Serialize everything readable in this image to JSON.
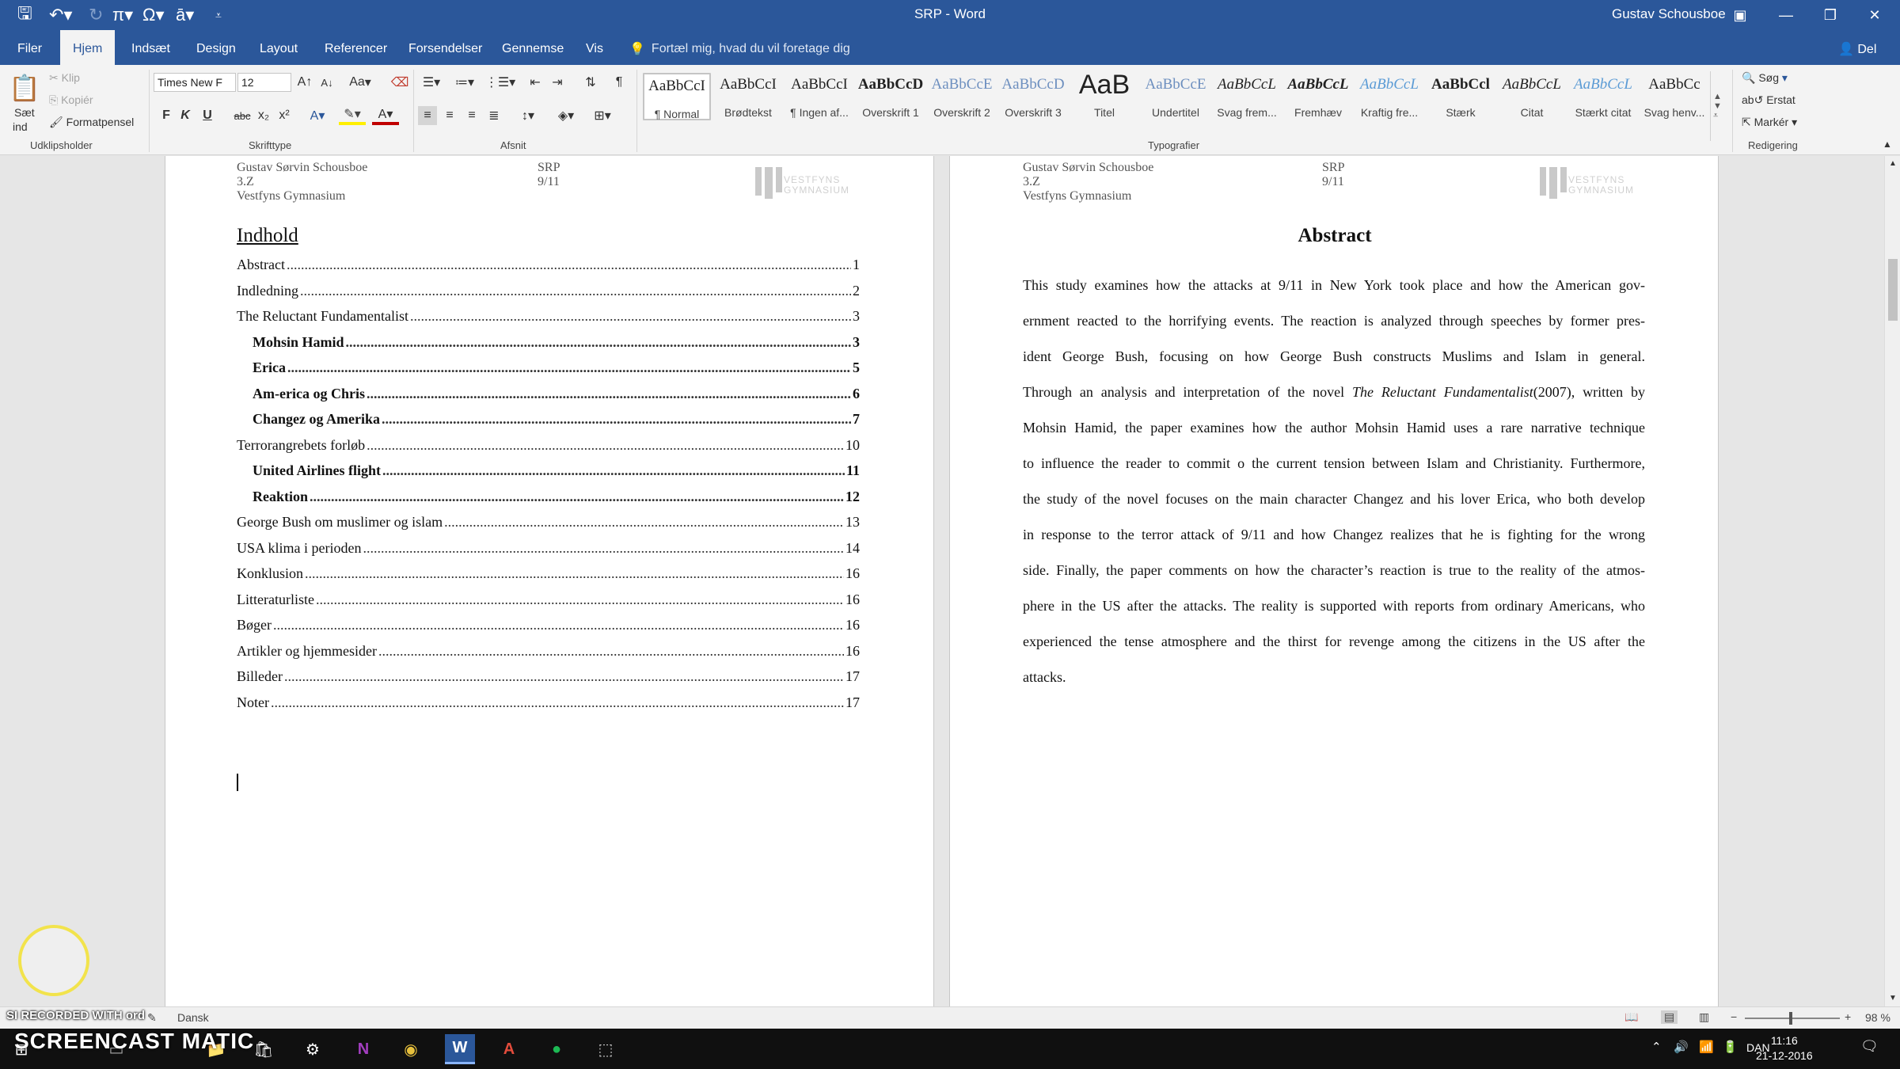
{
  "window": {
    "title": "SRP - Word",
    "user": "Gustav Schousboe"
  },
  "tabs": [
    "Filer",
    "Hjem",
    "Indsæt",
    "Design",
    "Layout",
    "Referencer",
    "Forsendelser",
    "Gennemse",
    "Vis"
  ],
  "active_tab": "Hjem",
  "tell_me": "Fortæl mig, hvad du vil foretage dig",
  "share": "Del",
  "clipboard": {
    "paste": "Sæt",
    "paste2": "ind",
    "cut": "Klip",
    "copy": "Kopiér",
    "format_painter": "Formatpensel",
    "label": "Udklipsholder"
  },
  "font": {
    "name": "Times New F",
    "size": "12",
    "label": "Skrifttype",
    "bold": "F",
    "italic": "K",
    "underline": "U",
    "strike": "abc",
    "sub": "x₂",
    "sup": "x²",
    "case": "Aa"
  },
  "paragraph": {
    "label": "Afsnit"
  },
  "styles": {
    "label": "Typografier",
    "items": [
      {
        "preview": "AaBbCcI",
        "name": "¶ Normal",
        "selected": true
      },
      {
        "preview": "AaBbCcI",
        "name": "Brødtekst"
      },
      {
        "preview": "AaBbCcI",
        "name": "¶ Ingen af..."
      },
      {
        "preview": "AaBbCcD",
        "name": "Overskrift 1"
      },
      {
        "preview": "AaBbCcE",
        "name": "Overskrift 2"
      },
      {
        "preview": "AaBbCcD",
        "name": "Overskrift 3"
      },
      {
        "preview": "AaB",
        "name": "Titel"
      },
      {
        "preview": "AaBbCcE",
        "name": "Undertitel"
      },
      {
        "preview": "AaBbCcL",
        "name": "Svag frem..."
      },
      {
        "preview": "AaBbCcL",
        "name": "Fremhæv"
      },
      {
        "preview": "AaBbCcL",
        "name": "Kraftig fre..."
      },
      {
        "preview": "AaBbCcl",
        "name": "Stærk"
      },
      {
        "preview": "AaBbCcL",
        "name": "Citat"
      },
      {
        "preview": "AaBbCcL",
        "name": "Stærkt citat"
      },
      {
        "preview": "AaBbCc",
        "name": "Svag henv..."
      }
    ]
  },
  "editing": {
    "find": "Søg",
    "replace": "Erstat",
    "select": "Markér",
    "label": "Redigering"
  },
  "page_header": {
    "name": "Gustav Sørvin Schousboe",
    "class": "3.Z",
    "school": "Vestfyns Gymnasium",
    "project": "SRP",
    "topic": "9/11",
    "logo_line1": "VESTFYNS",
    "logo_line2": "GYMNASIUM"
  },
  "toc": {
    "heading": "Indhold",
    "entries": [
      {
        "title": "Abstract",
        "page": "1"
      },
      {
        "title": "Indledning",
        "page": "2"
      },
      {
        "title": "The Reluctant Fundamentalist",
        "page": "3"
      },
      {
        "title": "Mohsin Hamid",
        "page": "3"
      },
      {
        "title": "Erica",
        "page": "5"
      },
      {
        "title": "Am-erica og Chris",
        "page": "6"
      },
      {
        "title": "Changez og Amerika",
        "page": "7"
      },
      {
        "title": "Terrorangrebets forløb",
        "page": "10"
      },
      {
        "title": "United Airlines flight",
        "page": "11"
      },
      {
        "title": "Reaktion",
        "page": "12"
      },
      {
        "title": "George Bush om muslimer og islam",
        "page": "13"
      },
      {
        "title": "USA klima i perioden",
        "page": "14"
      },
      {
        "title": "Konklusion",
        "page": "16"
      },
      {
        "title": "Litteraturliste",
        "page": "16"
      },
      {
        "title": "Bøger",
        "page": "16"
      },
      {
        "title": "Artikler og hjemmesider",
        "page": "16"
      },
      {
        "title": "Billeder",
        "page": "17"
      },
      {
        "title": "Noter",
        "page": "17"
      }
    ]
  },
  "abstract": {
    "heading": "Abstract",
    "lines": [
      "This study examines how the attacks at 9/11 in New York took place and how the American gov-",
      "ernment reacted to the horrifying events. The reaction is analyzed through speeches by former pres-",
      "ident George Bush, focusing on how George Bush constructs Muslims and Islam in general.",
      "Through an analysis and interpretation of the novel The Reluctant Fundamentalist(2007), written by",
      "Mohsin Hamid, the paper examines how the author Mohsin Hamid uses a rare narrative technique",
      "to influence the reader to commit o the current tension between Islam and Christianity. Furthermore,",
      "the study of the novel focuses on the main character Changez and his lover Erica, who both develop",
      "in response to the terror attack of 9/11 and how Changez realizes that he is fighting for the wrong",
      "side. Finally, the paper comments on how the character’s reaction is true to the reality of the atmos-",
      "phere in the US after the attacks. The reality is supported with reports from ordinary Americans, who",
      "experienced the tense atmosphere and the thirst for revenge among the citizens in the US after the",
      "attacks."
    ]
  },
  "status": {
    "words": "SI RECORDED WITH ord",
    "language": "Dansk",
    "zoom": "98 %"
  },
  "taskbar": {
    "time": "11:16",
    "date": "21-12-2016",
    "lang": "DAN",
    "recorder": "SCREENCAST  MATIC"
  }
}
